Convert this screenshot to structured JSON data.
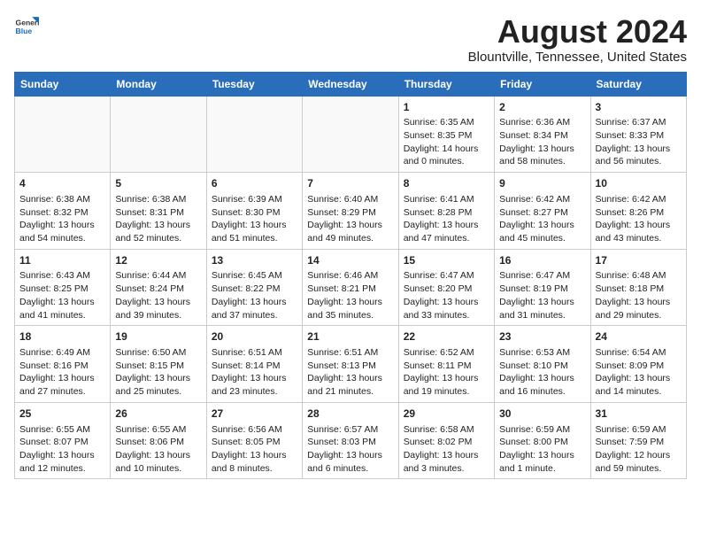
{
  "header": {
    "logo_general": "General",
    "logo_blue": "Blue",
    "month_year": "August 2024",
    "location": "Blountville, Tennessee, United States"
  },
  "weekdays": [
    "Sunday",
    "Monday",
    "Tuesday",
    "Wednesday",
    "Thursday",
    "Friday",
    "Saturday"
  ],
  "weeks": [
    [
      {
        "day": "",
        "info": ""
      },
      {
        "day": "",
        "info": ""
      },
      {
        "day": "",
        "info": ""
      },
      {
        "day": "",
        "info": ""
      },
      {
        "day": "1",
        "info": "Sunrise: 6:35 AM\nSunset: 8:35 PM\nDaylight: 14 hours\nand 0 minutes."
      },
      {
        "day": "2",
        "info": "Sunrise: 6:36 AM\nSunset: 8:34 PM\nDaylight: 13 hours\nand 58 minutes."
      },
      {
        "day": "3",
        "info": "Sunrise: 6:37 AM\nSunset: 8:33 PM\nDaylight: 13 hours\nand 56 minutes."
      }
    ],
    [
      {
        "day": "4",
        "info": "Sunrise: 6:38 AM\nSunset: 8:32 PM\nDaylight: 13 hours\nand 54 minutes."
      },
      {
        "day": "5",
        "info": "Sunrise: 6:38 AM\nSunset: 8:31 PM\nDaylight: 13 hours\nand 52 minutes."
      },
      {
        "day": "6",
        "info": "Sunrise: 6:39 AM\nSunset: 8:30 PM\nDaylight: 13 hours\nand 51 minutes."
      },
      {
        "day": "7",
        "info": "Sunrise: 6:40 AM\nSunset: 8:29 PM\nDaylight: 13 hours\nand 49 minutes."
      },
      {
        "day": "8",
        "info": "Sunrise: 6:41 AM\nSunset: 8:28 PM\nDaylight: 13 hours\nand 47 minutes."
      },
      {
        "day": "9",
        "info": "Sunrise: 6:42 AM\nSunset: 8:27 PM\nDaylight: 13 hours\nand 45 minutes."
      },
      {
        "day": "10",
        "info": "Sunrise: 6:42 AM\nSunset: 8:26 PM\nDaylight: 13 hours\nand 43 minutes."
      }
    ],
    [
      {
        "day": "11",
        "info": "Sunrise: 6:43 AM\nSunset: 8:25 PM\nDaylight: 13 hours\nand 41 minutes."
      },
      {
        "day": "12",
        "info": "Sunrise: 6:44 AM\nSunset: 8:24 PM\nDaylight: 13 hours\nand 39 minutes."
      },
      {
        "day": "13",
        "info": "Sunrise: 6:45 AM\nSunset: 8:22 PM\nDaylight: 13 hours\nand 37 minutes."
      },
      {
        "day": "14",
        "info": "Sunrise: 6:46 AM\nSunset: 8:21 PM\nDaylight: 13 hours\nand 35 minutes."
      },
      {
        "day": "15",
        "info": "Sunrise: 6:47 AM\nSunset: 8:20 PM\nDaylight: 13 hours\nand 33 minutes."
      },
      {
        "day": "16",
        "info": "Sunrise: 6:47 AM\nSunset: 8:19 PM\nDaylight: 13 hours\nand 31 minutes."
      },
      {
        "day": "17",
        "info": "Sunrise: 6:48 AM\nSunset: 8:18 PM\nDaylight: 13 hours\nand 29 minutes."
      }
    ],
    [
      {
        "day": "18",
        "info": "Sunrise: 6:49 AM\nSunset: 8:16 PM\nDaylight: 13 hours\nand 27 minutes."
      },
      {
        "day": "19",
        "info": "Sunrise: 6:50 AM\nSunset: 8:15 PM\nDaylight: 13 hours\nand 25 minutes."
      },
      {
        "day": "20",
        "info": "Sunrise: 6:51 AM\nSunset: 8:14 PM\nDaylight: 13 hours\nand 23 minutes."
      },
      {
        "day": "21",
        "info": "Sunrise: 6:51 AM\nSunset: 8:13 PM\nDaylight: 13 hours\nand 21 minutes."
      },
      {
        "day": "22",
        "info": "Sunrise: 6:52 AM\nSunset: 8:11 PM\nDaylight: 13 hours\nand 19 minutes."
      },
      {
        "day": "23",
        "info": "Sunrise: 6:53 AM\nSunset: 8:10 PM\nDaylight: 13 hours\nand 16 minutes."
      },
      {
        "day": "24",
        "info": "Sunrise: 6:54 AM\nSunset: 8:09 PM\nDaylight: 13 hours\nand 14 minutes."
      }
    ],
    [
      {
        "day": "25",
        "info": "Sunrise: 6:55 AM\nSunset: 8:07 PM\nDaylight: 13 hours\nand 12 minutes."
      },
      {
        "day": "26",
        "info": "Sunrise: 6:55 AM\nSunset: 8:06 PM\nDaylight: 13 hours\nand 10 minutes."
      },
      {
        "day": "27",
        "info": "Sunrise: 6:56 AM\nSunset: 8:05 PM\nDaylight: 13 hours\nand 8 minutes."
      },
      {
        "day": "28",
        "info": "Sunrise: 6:57 AM\nSunset: 8:03 PM\nDaylight: 13 hours\nand 6 minutes."
      },
      {
        "day": "29",
        "info": "Sunrise: 6:58 AM\nSunset: 8:02 PM\nDaylight: 13 hours\nand 3 minutes."
      },
      {
        "day": "30",
        "info": "Sunrise: 6:59 AM\nSunset: 8:00 PM\nDaylight: 13 hours\nand 1 minute."
      },
      {
        "day": "31",
        "info": "Sunrise: 6:59 AM\nSunset: 7:59 PM\nDaylight: 12 hours\nand 59 minutes."
      }
    ]
  ]
}
